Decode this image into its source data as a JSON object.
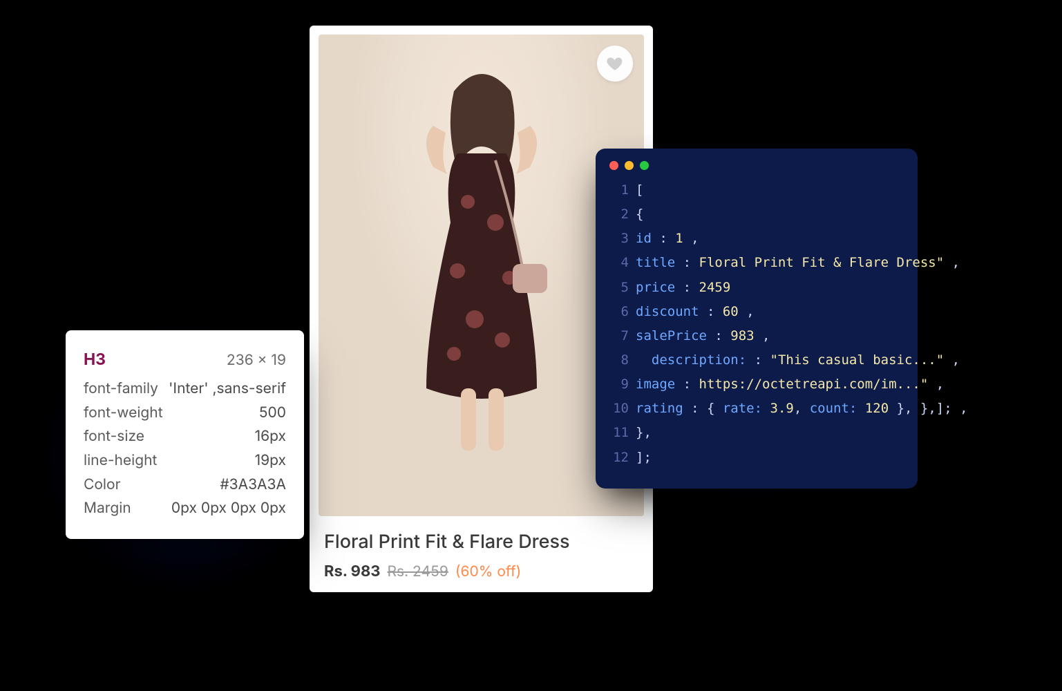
{
  "inspector": {
    "tag": "H3",
    "dimensions": "236 × 19",
    "rows": [
      {
        "k": "font-family",
        "v": "'Inter' ,sans-serif"
      },
      {
        "k": "font-weight",
        "v": "500"
      },
      {
        "k": "font-size",
        "v": "16px"
      },
      {
        "k": "line-height",
        "v": "19px"
      },
      {
        "k": "Color",
        "v": "#3A3A3A"
      },
      {
        "k": "Margin",
        "v": "0px 0px 0px 0px"
      }
    ]
  },
  "product": {
    "title": "Floral Print Fit & Flare Dress",
    "salePriceLabel": "Rs. 983",
    "originalPriceLabel": "Rs. 2459",
    "discountLabel": "(60% off)"
  },
  "code": {
    "lines": [
      {
        "n": "1",
        "seg": [
          {
            "c": "pun",
            "t": "["
          }
        ]
      },
      {
        "n": "2",
        "seg": [
          {
            "c": "pun",
            "t": "{"
          }
        ]
      },
      {
        "n": "3",
        "seg": [
          {
            "c": "key",
            "t": "id"
          },
          {
            "c": "pun",
            "t": " : "
          },
          {
            "c": "num",
            "t": "1"
          },
          {
            "c": "pun",
            "t": " ,"
          }
        ]
      },
      {
        "n": "4",
        "seg": [
          {
            "c": "key",
            "t": "title"
          },
          {
            "c": "pun",
            "t": " : "
          },
          {
            "c": "str",
            "t": "Floral Print Fit & Flare Dress\""
          },
          {
            "c": "pun",
            "t": " ,"
          }
        ]
      },
      {
        "n": "5",
        "seg": [
          {
            "c": "key",
            "t": "price"
          },
          {
            "c": "pun",
            "t": " : "
          },
          {
            "c": "num",
            "t": "2459"
          }
        ]
      },
      {
        "n": "6",
        "seg": [
          {
            "c": "key",
            "t": "discount"
          },
          {
            "c": "pun",
            "t": " : "
          },
          {
            "c": "num",
            "t": "60"
          },
          {
            "c": "pun",
            "t": " ,"
          }
        ]
      },
      {
        "n": "7",
        "seg": [
          {
            "c": "key",
            "t": "salePrice"
          },
          {
            "c": "pun",
            "t": " : "
          },
          {
            "c": "num",
            "t": "983"
          },
          {
            "c": "pun",
            "t": " ,"
          }
        ]
      },
      {
        "n": "8",
        "seg": [
          {
            "c": "pun",
            "t": "  "
          },
          {
            "c": "key",
            "t": "description:"
          },
          {
            "c": "pun",
            "t": " : "
          },
          {
            "c": "str",
            "t": "\"This casual basic...\""
          },
          {
            "c": "pun",
            "t": " ,"
          }
        ]
      },
      {
        "n": "9",
        "seg": [
          {
            "c": "key",
            "t": "image"
          },
          {
            "c": "pun",
            "t": " : "
          },
          {
            "c": "str",
            "t": "https://octetreapi.com/im...\""
          },
          {
            "c": "pun",
            "t": " ,"
          }
        ]
      },
      {
        "n": "10",
        "seg": [
          {
            "c": "key",
            "t": "rating"
          },
          {
            "c": "pun",
            "t": " : { "
          },
          {
            "c": "key",
            "t": "rate:"
          },
          {
            "c": "pun",
            "t": " "
          },
          {
            "c": "num",
            "t": "3.9"
          },
          {
            "c": "pun",
            "t": ", "
          },
          {
            "c": "key",
            "t": "count:"
          },
          {
            "c": "pun",
            "t": " "
          },
          {
            "c": "num",
            "t": "120"
          },
          {
            "c": "pun",
            "t": " }, },]; ,"
          }
        ]
      },
      {
        "n": "11",
        "seg": [
          {
            "c": "pun",
            "t": "},"
          }
        ]
      },
      {
        "n": "12",
        "seg": [
          {
            "c": "pun",
            "t": "];"
          }
        ]
      }
    ]
  }
}
